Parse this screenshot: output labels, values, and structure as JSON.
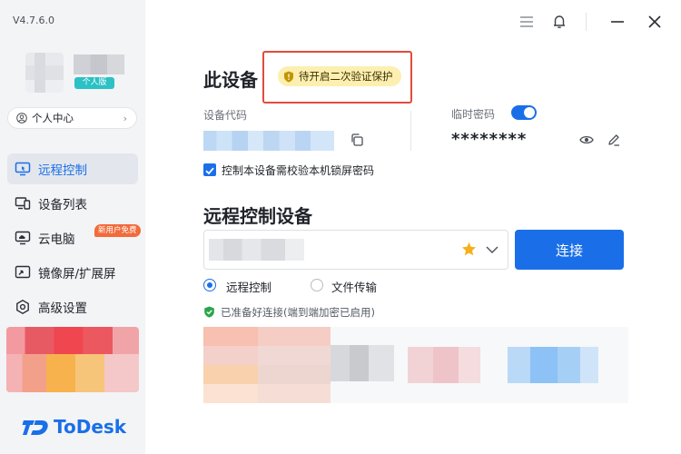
{
  "app": {
    "version": "V4.7.6.0",
    "brand_name": "ToDesk",
    "account_badge": "个人版",
    "profile_label": "个人中心"
  },
  "sidebar": {
    "items": [
      {
        "label": "远程控制",
        "icon": "remote-control-icon",
        "active": true
      },
      {
        "label": "设备列表",
        "icon": "device-list-icon",
        "active": false
      },
      {
        "label": "云电脑",
        "icon": "cloud-pc-icon",
        "active": false,
        "tag": "新用户免费"
      },
      {
        "label": "镜像屏/扩展屏",
        "icon": "mirror-screen-icon",
        "active": false
      },
      {
        "label": "高级设置",
        "icon": "advanced-settings-icon",
        "active": false
      }
    ]
  },
  "this_device": {
    "title": "此设备",
    "security_status": "待开启二次验证保护",
    "device_code_label": "设备代码",
    "temp_password_label": "临时密码",
    "temp_password_enabled": true,
    "temp_password_value": "********",
    "lock_screen_check_label": "控制本设备需校验本机锁屏密码",
    "lock_screen_check_checked": true
  },
  "remote_device": {
    "title": "远程控制设备",
    "connect_label": "连接",
    "modes": [
      {
        "label": "远程控制",
        "selected": true
      },
      {
        "label": "文件传输",
        "selected": false
      }
    ],
    "status_text": "已准备好连接(端到端加密已启用)"
  },
  "colors": {
    "accent": "#1a6fe8",
    "warning_pill_bg": "#fcefb0",
    "highlight_border": "#e14b3b",
    "new_tag": "#f26b3a",
    "ready_green": "#2aa54a"
  }
}
